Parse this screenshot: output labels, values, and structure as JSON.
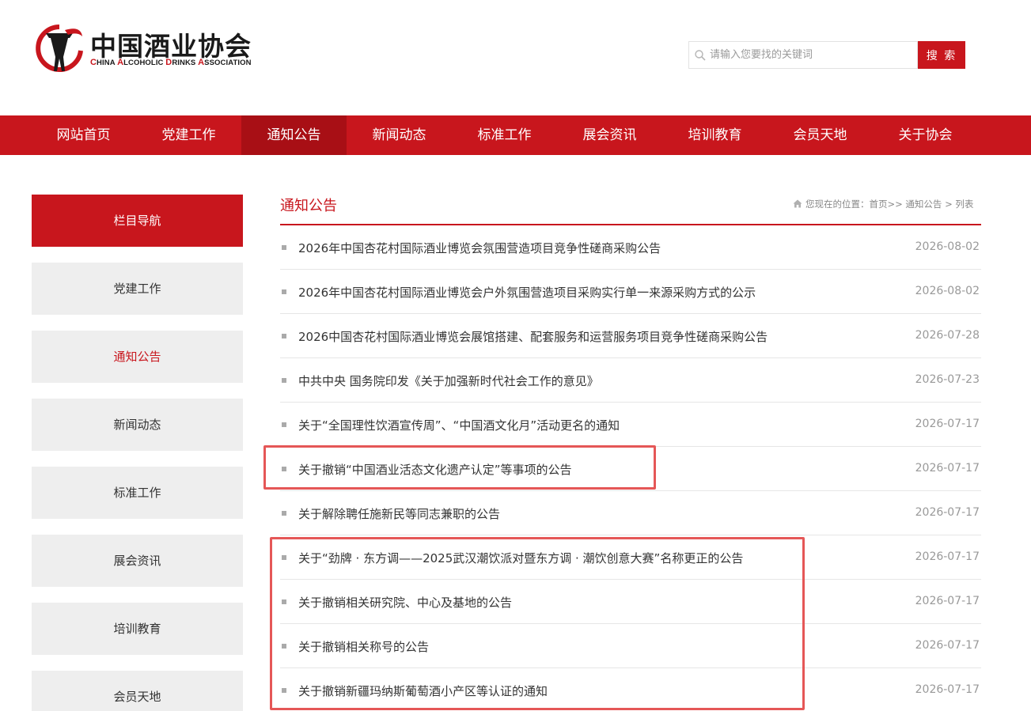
{
  "header": {
    "logo_cn": "中国酒业协会",
    "logo_en_parts": [
      {
        "cap": "C",
        "rest": "HINA "
      },
      {
        "cap": "A",
        "rest": "LCOHOLIC "
      },
      {
        "cap": "D",
        "rest": "RINKS "
      },
      {
        "cap": "A",
        "rest": "SSOCIATION"
      }
    ],
    "search_placeholder": "请输入您要找的关键词",
    "search_button": "搜 索"
  },
  "nav": {
    "items": [
      "网站首页",
      "党建工作",
      "通知公告",
      "新闻动态",
      "标准工作",
      "展会资讯",
      "培训教育",
      "会员天地",
      "关于协会"
    ],
    "active": "通知公告"
  },
  "sidebar": {
    "heading": "栏目导航",
    "items": [
      "党建工作",
      "通知公告",
      "新闻动态",
      "标准工作",
      "展会资讯",
      "培训教育",
      "会员天地"
    ],
    "active": "通知公告"
  },
  "main": {
    "title": "通知公告",
    "breadcrumb": "您现在的位置：首页>> 通知公告 > 列表",
    "articles": [
      {
        "title": "2026年中国杏花村国际酒业博览会氛围营造项目竞争性磋商采购公告",
        "date": "2026-08-02"
      },
      {
        "title": "2026年中国杏花村国际酒业博览会户外氛围营造项目采购实行单一来源采购方式的公示",
        "date": "2026-08-02"
      },
      {
        "title": "2026中国杏花村国际酒业博览会展馆搭建、配套服务和运营服务项目竞争性磋商采购公告",
        "date": "2026-07-28"
      },
      {
        "title": "中共中央 国务院印发《关于加强新时代社会工作的意见》",
        "date": "2026-07-23"
      },
      {
        "title": "关于“全国理性饮酒宣传周”、“中国酒文化月”活动更名的通知",
        "date": "2026-07-17"
      },
      {
        "title": "关于撤销“中国酒业活态文化遗产认定”等事项的公告",
        "date": "2026-07-17"
      },
      {
        "title": "关于解除聘任施新民等同志兼职的公告",
        "date": "2026-07-17"
      },
      {
        "title": "关于“劲牌 · 东方调——2025武汉潮饮派对暨东方调 · 潮饮创意大赛”名称更正的公告",
        "date": "2026-07-17"
      },
      {
        "title": "关于撤销相关研究院、中心及基地的公告",
        "date": "2026-07-17"
      },
      {
        "title": "关于撤销相关称号的公告",
        "date": "2026-07-17"
      },
      {
        "title": "关于撤销新疆玛纳斯葡萄酒小产区等认证的通知",
        "date": "2026-07-17"
      }
    ]
  },
  "colors": {
    "brand_red": "#c8161d",
    "nav_active": "#a80f15",
    "highlight": "#e55757"
  }
}
